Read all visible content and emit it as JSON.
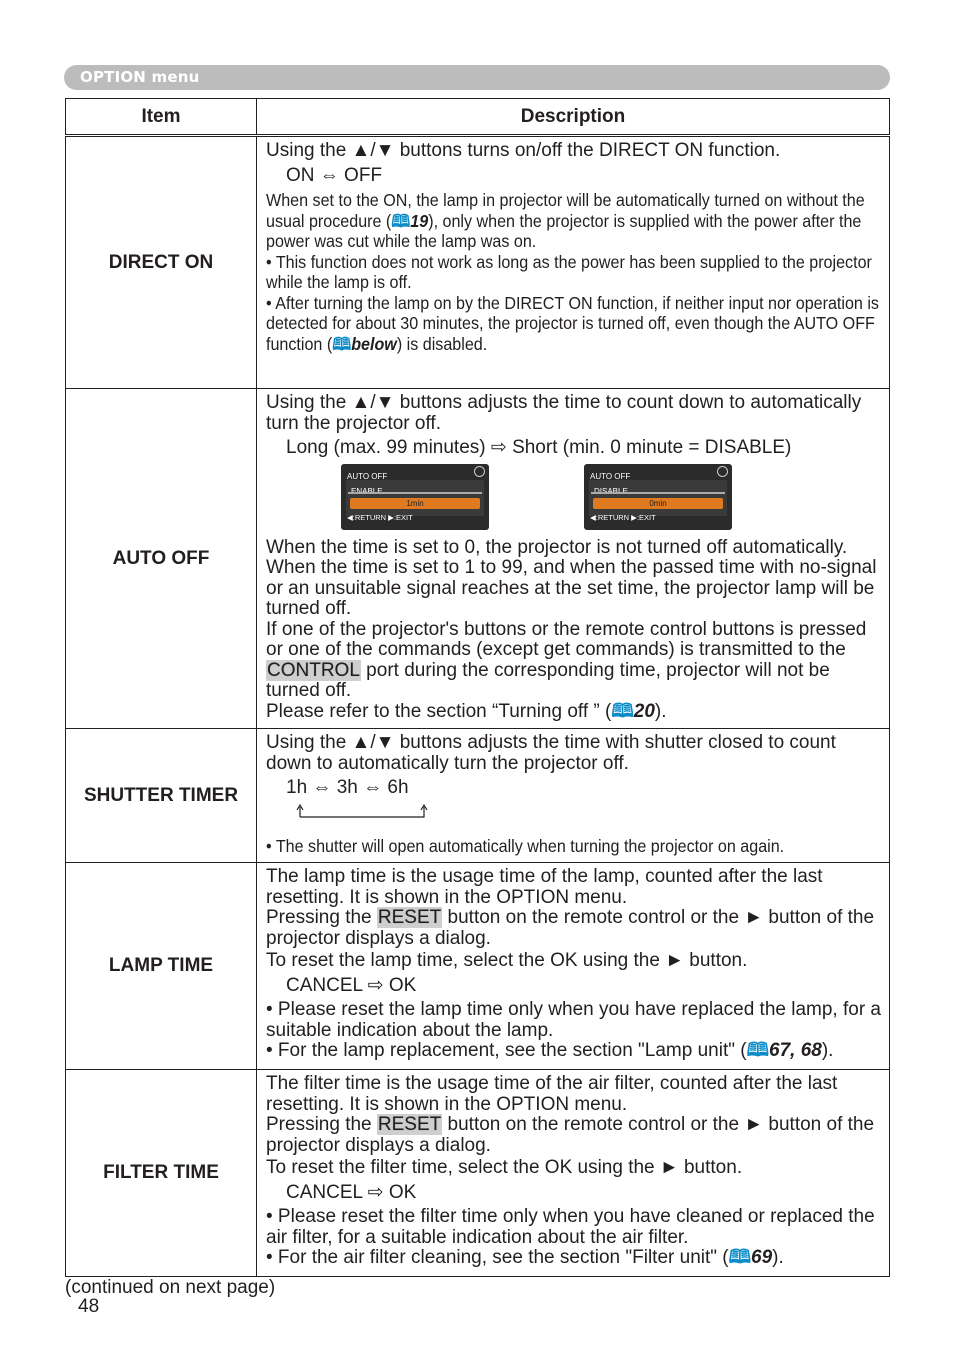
{
  "section_title": "OPTION menu",
  "table": {
    "headers": {
      "item": "Item",
      "description": "Description"
    },
    "rows": {
      "direct_on": {
        "item": "DIRECT ON",
        "line1": "Using the ▲/▼ buttons turns on/off the DIRECT ON function.",
        "options": "ON ⇔ OFF",
        "note1a": "When set to the ON, the lamp in projector will be automatically turned on without the usual procedure (",
        "note1_ref": "19",
        "note1b": "), only when the projector is supplied with the power after the power was cut while the lamp was on.",
        "note2": "• This function does not work as long as the power has been supplied to the projector while the lamp is off.",
        "note3a": "• After turning the lamp on by the DIRECT ON function, if neither input nor operation is detected for about 30 minutes, the projector is turned off, even though the AUTO OFF function (",
        "note3_ref": "below",
        "note3b": ") is disabled."
      },
      "auto_off": {
        "item": "AUTO OFF",
        "line1": "Using the ▲/▼ buttons adjusts the time to count down to automatically turn the projector off.",
        "options": "Long (max. 99 minutes) ⇨ Short (min. 0 minute = DISABLE)",
        "screen1": {
          "title": "AUTO OFF",
          "label": "ENABLE",
          "value": "1min",
          "footer": "◀:RETURN   ▶:EXIT"
        },
        "screen2": {
          "title": "AUTO OFF",
          "label": "DISABLE",
          "value": "0min",
          "footer": "◀:RETURN   ▶:EXIT"
        },
        "p1": "When the time is set to 0, the projector is not turned off automatically. When the time is set to 1 to 99, and when the passed time with no-signal or an unsuitable signal reaches at the set time, the projector lamp will be turned off.",
        "p2a": "If one of the projector's buttons or the remote control buttons is pressed or one of the commands (except get commands) is transmitted to the ",
        "p2_hl": "CONTROL",
        "p2b": " port during the corresponding time, projector will not be turned off.",
        "p3a": "Please refer to the section “Turning off ” (",
        "p3_ref": "20",
        "p3b": ")."
      },
      "shutter_timer": {
        "item": "SHUTTER TIMER",
        "line1": "Using the ▲/▼ buttons adjusts the time with shutter closed to count down to automatically turn the projector off.",
        "options": "1h ⇔ 3h ⇔ 6h",
        "note": "• The shutter will open automatically when turning the projector on again."
      },
      "lamp_time": {
        "item": "LAMP TIME",
        "p1": "The lamp time is the usage time of the lamp, counted after the last resetting. It is shown in the OPTION menu.",
        "p2a": "Pressing the ",
        "p2_hl": "RESET",
        "p2b": " button on the remote control or the ► button of the projector displays a dialog.",
        "p3": "To reset the lamp time, select the OK using the ► button.",
        "options": "CANCEL ⇨ OK",
        "n1": "• Please reset the lamp time only when you have replaced the lamp, for a suitable indication about the lamp.",
        "n2a": "• For the lamp replacement, see the section \"Lamp unit\" (",
        "n2_ref": "67, 68",
        "n2b": ")."
      },
      "filter_time": {
        "item": "FILTER TIME",
        "p1": "The filter time is the usage time of the air filter, counted after the last resetting. It is shown in the OPTION menu.",
        "p2a": "Pressing the ",
        "p2_hl": "RESET",
        "p2b": " button on the remote control or the ► button of the projector displays a dialog.",
        "p3": "To reset the filter time, select the OK using the ► button.",
        "options": "CANCEL ⇨ OK",
        "n1": "• Please reset the filter time only when you have cleaned or replaced the air filter, for a suitable indication about the air filter.",
        "n2a": "• For the air filter cleaning, see the section \"Filter unit\" (",
        "n2_ref": "69",
        "n2b": ")."
      }
    }
  },
  "footer": {
    "continued": "(continued on next page)",
    "page_number": "48"
  },
  "colors": {
    "ref_icon": "#0b8bc7",
    "osd_highlight": "#e07a20",
    "section_bar": "#bcbcbc"
  }
}
